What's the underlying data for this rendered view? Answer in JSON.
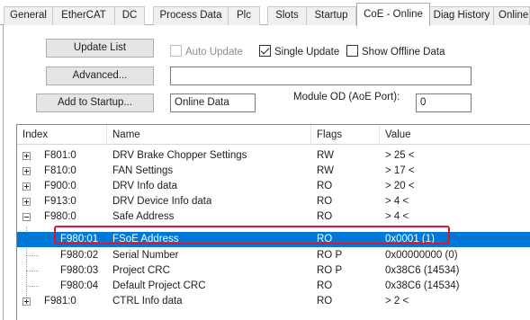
{
  "tabs": [
    {
      "label": "General",
      "active": false
    },
    {
      "label": "EtherCAT",
      "active": false
    },
    {
      "label": "DC",
      "active": false
    },
    {
      "label": "Process Data",
      "active": false
    },
    {
      "label": "Plc",
      "active": false
    },
    {
      "label": "Slots",
      "active": false
    },
    {
      "label": "Startup",
      "active": false
    },
    {
      "label": "CoE - Online",
      "active": true
    },
    {
      "label": "Diag History",
      "active": false
    },
    {
      "label": "Online",
      "active": false
    }
  ],
  "toolbar": {
    "update_list": "Update List",
    "advanced": "Advanced...",
    "add_to_startup": "Add to Startup...",
    "auto_update": {
      "label": "Auto Update",
      "checked": false,
      "enabled": false
    },
    "single_update": {
      "label": "Single Update",
      "checked": true
    },
    "show_offline": {
      "label": "Show Offline Data",
      "checked": false
    },
    "status_field": "Online Data",
    "module_od_label": "Module OD (AoE Port):",
    "module_od_value": "0"
  },
  "table": {
    "columns": [
      "Index",
      "Name",
      "Flags",
      "Value"
    ],
    "rows": [
      {
        "index": "F801:0",
        "name": "DRV Brake Chopper Settings",
        "flags": "RW",
        "value": "> 25 <",
        "expander": "plus"
      },
      {
        "index": "F810:0",
        "name": "FAN Settings",
        "flags": "RW",
        "value": "> 17 <",
        "expander": "plus"
      },
      {
        "index": "F900:0",
        "name": "DRV Info data",
        "flags": "RO",
        "value": "> 20 <",
        "expander": "plus"
      },
      {
        "index": "F913:0",
        "name": "DRV Device Info data",
        "flags": "RO",
        "value": "> 4 <",
        "expander": "plus"
      },
      {
        "index": "F980:0",
        "name": "Safe Address",
        "flags": "RO",
        "value": "> 4 <",
        "expander": "minus"
      },
      {
        "index": "F980:01",
        "name": "FSoE Address",
        "flags": "RO",
        "value": "0x0001 (1)",
        "selected": true
      },
      {
        "index": "F980:02",
        "name": "Serial Number",
        "flags": "RO P",
        "value": "0x00000000 (0)"
      },
      {
        "index": "F980:03",
        "name": "Project CRC",
        "flags": "RO P",
        "value": "0x38C6 (14534)"
      },
      {
        "index": "F980:04",
        "name": "Default Project CRC",
        "flags": "RO",
        "value": "0x38C6 (14534)"
      },
      {
        "index": "F981:0",
        "name": "CTRL Info data",
        "flags": "RO",
        "value": "> 2 <",
        "expander": "plus"
      }
    ]
  },
  "colors": {
    "selection": "#0078d7",
    "highlight_box": "#e8102a"
  }
}
